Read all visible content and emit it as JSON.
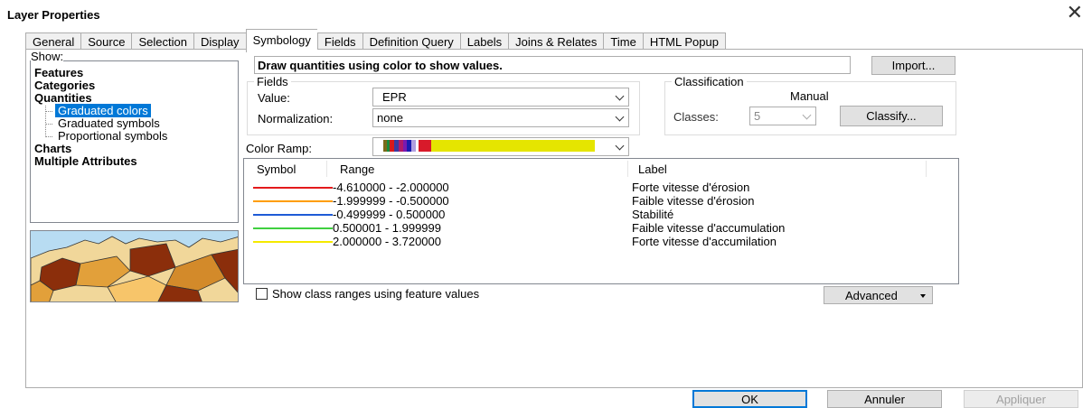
{
  "window": {
    "title": "Layer Properties",
    "close_glyph": "✕"
  },
  "tabs": [
    "General",
    "Source",
    "Selection",
    "Display",
    "Symbology",
    "Fields",
    "Definition Query",
    "Labels",
    "Joins & Relates",
    "Time",
    "HTML Popup"
  ],
  "active_tab": "Symbology",
  "show": {
    "label": "Show:",
    "items": [
      {
        "label": "Features",
        "kind": "group"
      },
      {
        "label": "Categories",
        "kind": "group"
      },
      {
        "label": "Quantities",
        "kind": "group"
      },
      {
        "label": "Graduated colors",
        "kind": "sub",
        "selected": true
      },
      {
        "label": "Graduated symbols",
        "kind": "sub"
      },
      {
        "label": "Proportional symbols",
        "kind": "sub"
      },
      {
        "label": "Charts",
        "kind": "group"
      },
      {
        "label": "Multiple Attributes",
        "kind": "group"
      }
    ]
  },
  "description": "Draw quantities using color to show values.",
  "import_button": "Import...",
  "fields": {
    "title": "Fields",
    "value_label": "Value:",
    "value": "EPR",
    "normalization_label": "Normalization:",
    "normalization": "none"
  },
  "classification": {
    "title": "Classification",
    "method": "Manual",
    "classes_label": "Classes:",
    "classes": "5",
    "classify_button": "Classify..."
  },
  "color_ramp": {
    "label": "Color Ramp:",
    "colors": [
      "#ffffff",
      "#7a6a1a",
      "#1a8a3a",
      "#d81a1a",
      "#3a3aa0",
      "#b01a6a",
      "#7a1ab0",
      "#1a1ab0",
      "#b0a0e0",
      "#ffffff",
      "#d81a2a",
      "#e5e500"
    ]
  },
  "table": {
    "headers": {
      "symbol": "Symbol",
      "range": "Range",
      "label": "Label"
    },
    "rows": [
      {
        "color": "#e31a1c",
        "range": "-4.610000 - -2.000000",
        "label": "Forte vitesse d'érosion"
      },
      {
        "color": "#ff9d00",
        "range": "-1.999999 - -0.500000",
        "label": "Faible vitesse d'érosion"
      },
      {
        "color": "#1f5bd6",
        "range": "-0.499999 - 0.500000",
        "label": "Stabilité"
      },
      {
        "color": "#40d040",
        "range": "0.500001 - 1.999999",
        "label": "Faible vitesse d'accumulation"
      },
      {
        "color": "#f5ea00",
        "range": "2.000000 - 3.720000",
        "label": "Forte vitesse d'accumilation"
      }
    ]
  },
  "show_class_ranges": {
    "label": "Show class ranges using feature values",
    "checked": false
  },
  "advanced_button": "Advanced",
  "footer": {
    "ok": "OK",
    "cancel": "Annuler",
    "apply": "Appliquer"
  }
}
